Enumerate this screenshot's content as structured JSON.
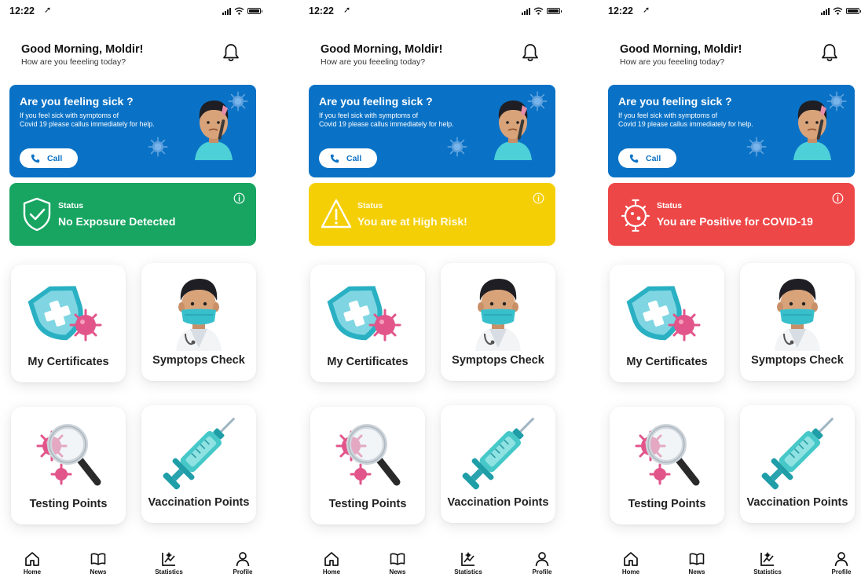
{
  "status_bar": {
    "time": "12:22"
  },
  "greeting": {
    "title": "Good Morning, Moldir!",
    "subtitle": "How are you feeeling today?"
  },
  "sick_card": {
    "title": "Are you feeling sick ?",
    "text_line1": "If you feel sick with symptoms of",
    "text_line2": "Covid 19 please callus immediately for help.",
    "call_label": "Call",
    "background": "#0a72c6"
  },
  "screens": [
    {
      "status": {
        "label": "Status",
        "value": "No Exposure Detected",
        "color": "#17a561",
        "icon": "shield-check-icon"
      }
    },
    {
      "status": {
        "label": "Status",
        "value": "You are at High Risk!",
        "color": "#f5cf06",
        "icon": "warning-triangle-icon"
      }
    },
    {
      "status": {
        "label": "Status",
        "value": "You are Positive for COVID-19",
        "color": "#ee4747",
        "icon": "virus-icon"
      }
    }
  ],
  "tiles": [
    {
      "label": "My Certificates",
      "icon": "shield-virus-icon"
    },
    {
      "label": "Symptops Check",
      "icon": "doctor-mask-icon"
    },
    {
      "label": "Testing Points",
      "icon": "magnifier-virus-icon"
    },
    {
      "label": "Vaccination Points",
      "icon": "syringe-icon"
    }
  ],
  "tabs": [
    {
      "label": "Home",
      "icon": "home-icon"
    },
    {
      "label": "News",
      "icon": "book-icon"
    },
    {
      "label": "Statistics",
      "icon": "chart-icon"
    },
    {
      "label": "Profile",
      "icon": "person-icon"
    }
  ]
}
